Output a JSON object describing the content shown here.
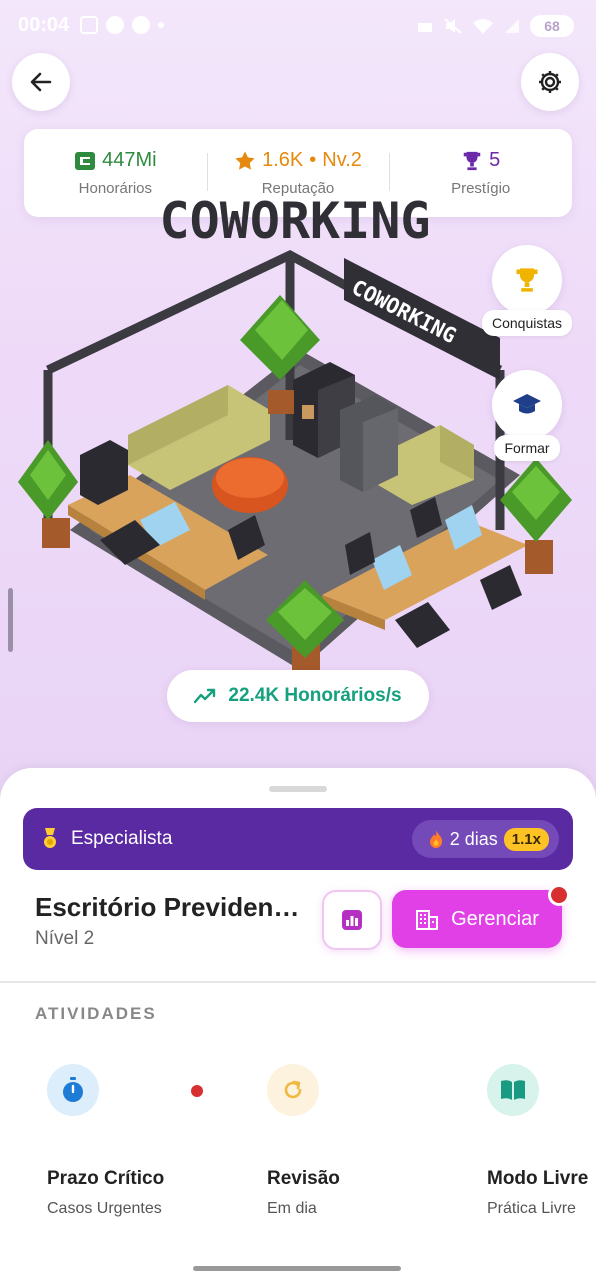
{
  "status_bar": {
    "time": "00:04",
    "battery": "68"
  },
  "stats": {
    "fees": {
      "value": "447Mi",
      "label": "Honorários"
    },
    "reputation": {
      "value": "1.6K",
      "separator": "•",
      "level": "Nv.2",
      "label": "Reputação"
    },
    "prestige": {
      "value": "5",
      "label": "Prestígio"
    }
  },
  "scene": {
    "title_sign": "COWORKING",
    "room_sign": "COWORKING"
  },
  "side_actions": {
    "achievements_label": "Conquistas",
    "train_label": "Formar"
  },
  "rate": {
    "text": "22.4K Honorários/s"
  },
  "rank": {
    "title": "Especialista",
    "streak": "2 dias",
    "multiplier": "1.1x"
  },
  "office": {
    "name": "Escritório Previdenci...",
    "level": "Nível 2",
    "manage_label": "Gerenciar"
  },
  "activities": {
    "section_title": "ATIVIDADES",
    "items": [
      {
        "title": "Prazo Crítico",
        "subtitle": "Casos Urgentes",
        "icon": "stopwatch-icon"
      },
      {
        "title": "Revisão",
        "subtitle": "Em dia",
        "icon": "refresh-icon"
      },
      {
        "title": "Modo Livre",
        "subtitle": "Prática Livre",
        "icon": "book-icon"
      }
    ]
  },
  "colors": {
    "primary_purple": "#5a2aa3",
    "accent_magenta": "#e040e6",
    "rate_green": "#15a07e",
    "fees_green": "#2e8b3e",
    "reputation_orange": "#e58a0f"
  }
}
